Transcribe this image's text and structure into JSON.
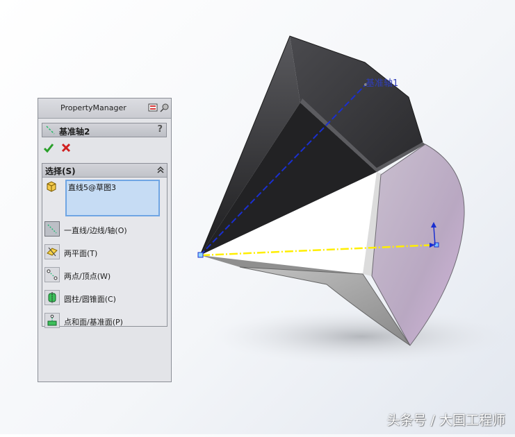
{
  "viewport": {
    "axis_label": "基准轴1",
    "watermark": "头条号 / 大国工程师"
  },
  "property_manager": {
    "title": "PropertyManager",
    "feature_name": "基准轴2",
    "help_label": "?",
    "selection": {
      "title": "选择(S)",
      "selected_items": [
        "直线5@草图3"
      ],
      "options": [
        {
          "label": "一直线/边线/轴(O)",
          "icon": "line-edge-axis-icon",
          "active": true
        },
        {
          "label": "两平面(T)",
          "icon": "two-planes-icon",
          "active": false
        },
        {
          "label": "两点/顶点(W)",
          "icon": "two-points-icon",
          "active": false
        },
        {
          "label": "圆柱/圆锥面(C)",
          "icon": "cylinder-cone-icon",
          "active": false
        },
        {
          "label": "点和面/基准面(P)",
          "icon": "point-plane-icon",
          "active": false
        }
      ]
    }
  },
  "colors": {
    "accent": "#6fa5e3",
    "selection_fill": "#c6dcf4",
    "ok_green": "#2aa02a",
    "cancel_red": "#d02020",
    "axis_blue": "#1a2fd0",
    "axis_yellow": "#ffee00"
  }
}
